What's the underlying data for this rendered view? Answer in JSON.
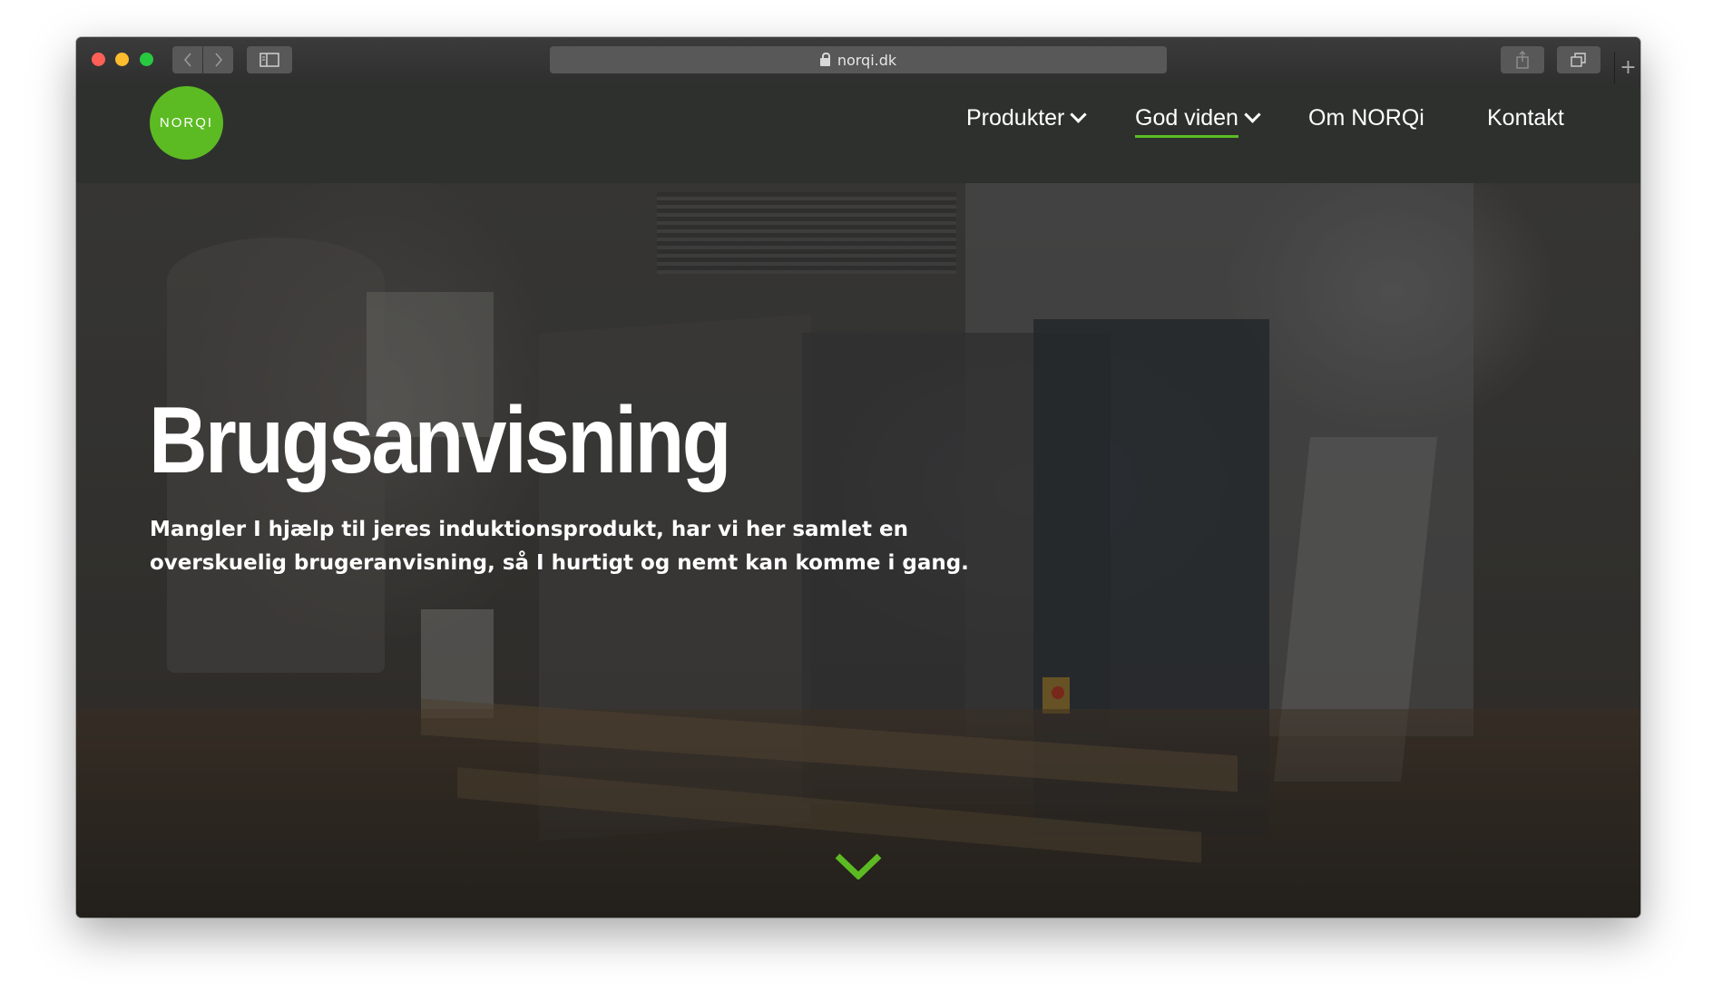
{
  "browser": {
    "url": "norqi.dk",
    "new_tab": "+"
  },
  "site": {
    "logo_text": "NORQI",
    "accent": "#5cbb23",
    "nav": {
      "produkter": "Produkter",
      "god_viden": "God viden",
      "om": "Om NORQi",
      "kontakt": "Kontakt"
    },
    "active_nav": "God viden"
  },
  "hero": {
    "title": "Brugsanvisning",
    "text": "Mangler I hjælp til jeres induktionsprodukt, har vi her samlet en overskuelig brugeranvisning, så I hurtigt og nemt kan komme i gang."
  },
  "icons": {
    "lock": "lock-icon",
    "scroll": "chevron-down-icon"
  }
}
